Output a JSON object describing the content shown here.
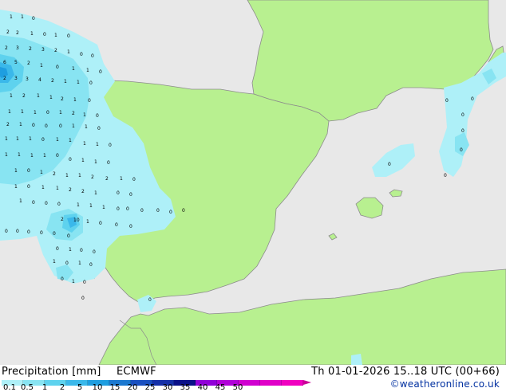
{
  "legend": {
    "title": "Precipitation [mm]",
    "model": "ECMWF",
    "ticks": [
      "0.1",
      "0.5",
      "1",
      "2",
      "5",
      "10",
      "15",
      "20",
      "25",
      "30",
      "35",
      "40",
      "45",
      "50"
    ],
    "colors": [
      "#aef0f8",
      "#88e4f2",
      "#5ed2ee",
      "#3ab8ea",
      "#1e9ee0",
      "#1a78d0",
      "#1a50c0",
      "#1530a8",
      "#0a1088",
      "#9000d8",
      "#b000d8",
      "#d000d0",
      "#e000c8",
      "#f000c0"
    ]
  },
  "valid_time": "Th 01-01-2026 15..18 UTC (00+66)",
  "credit": "©weatheronline.co.uk",
  "map": {
    "land_color": "#b8f090",
    "sea_color": "#e8e8e8",
    "precip_labels": [
      [
        "1",
        "1",
        "0"
      ],
      [
        "2",
        "2",
        "1",
        "0",
        "1",
        "0"
      ],
      [
        "2",
        "3",
        "2",
        "3",
        "2",
        "1",
        "0",
        "0"
      ],
      [
        "6",
        "5",
        "2",
        "1",
        "0",
        "1",
        "1",
        "0"
      ],
      [
        "2",
        "3",
        "3",
        "4",
        "2",
        "1",
        "1",
        "0"
      ],
      [
        "1",
        "2",
        "1",
        "1",
        "2",
        "1",
        "0"
      ],
      [
        "1",
        "1",
        "1",
        "0",
        "1",
        "2",
        "1",
        "0"
      ],
      [
        "2",
        "1",
        "0",
        "0",
        "0",
        "1",
        "1",
        "0"
      ],
      [
        "1",
        "1",
        "1",
        "0",
        "1",
        "1",
        "1",
        "1",
        "0"
      ],
      [
        "1",
        "1",
        "1",
        "1",
        "0",
        "0",
        "1",
        "1",
        "0"
      ],
      [
        "1",
        "0",
        "1",
        "2",
        "1",
        "1",
        "2",
        "2",
        "1",
        "0"
      ],
      [
        "1",
        "0",
        "1",
        "1",
        "2",
        "2",
        "1",
        "0",
        "0"
      ],
      [
        "1",
        "0",
        "0",
        "0",
        "1",
        "1",
        "1",
        "0"
      ],
      [
        "2",
        "10",
        "1",
        "0"
      ],
      [
        "0",
        "0",
        "0",
        "0",
        "0",
        "0"
      ],
      [
        "0",
        "1",
        "0",
        "0"
      ],
      [
        "1",
        "0",
        "1",
        "0"
      ],
      [
        "0",
        "1",
        "0"
      ],
      [
        "0"
      ],
      [
        "0",
        "0",
        "0",
        "0"
      ],
      [
        "0",
        "0",
        "0"
      ],
      [
        "0",
        "0"
      ],
      [
        "0"
      ],
      [
        "0"
      ],
      [
        "0"
      ],
      [
        "0",
        "0"
      ],
      [
        "0"
      ]
    ]
  }
}
